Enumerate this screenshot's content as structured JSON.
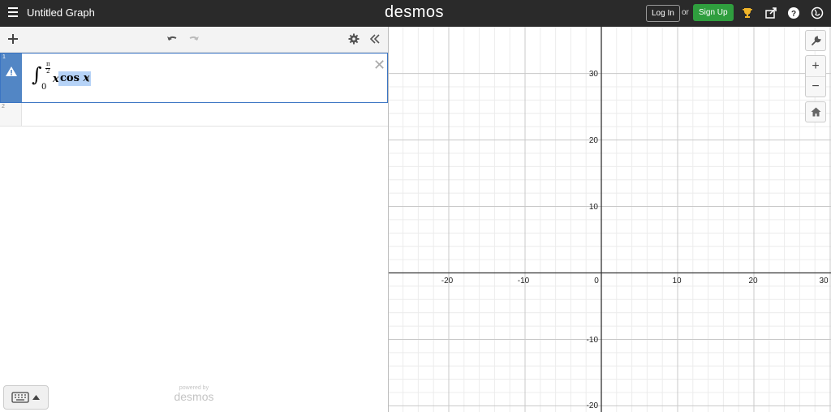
{
  "header": {
    "title": "Untitled Graph",
    "logo": "desmos",
    "login_label": "Log In",
    "or_label": "or",
    "signup_label": "Sign Up",
    "icons": [
      "menu-icon",
      "trophy-icon",
      "share-icon",
      "help-icon",
      "globe-icon"
    ]
  },
  "toolbar": {
    "icons": [
      "add-icon",
      "undo-icon",
      "redo-icon",
      "gear-icon",
      "collapse-icon"
    ]
  },
  "expressions": [
    {
      "index": "1",
      "status_icon": "warning-icon",
      "integral_lower": "0",
      "integral_upper_num": "π",
      "integral_upper_den": "2",
      "body_x": "x",
      "body_cos": "cos",
      "body_x2": "x"
    },
    {
      "index": "2"
    }
  ],
  "footer": {
    "powered_by": "powered by",
    "powered_logo": "desmos",
    "keyboard_icon": "keyboard-icon"
  },
  "graph_controls": {
    "wrench": "wrench-icon",
    "zoom_in": "+",
    "zoom_out": "−",
    "home": "home-icon"
  },
  "axis": {
    "x_labels": [
      "-20",
      "-10",
      "0",
      "10",
      "20",
      "30"
    ],
    "y_labels": [
      "30",
      "20",
      "10",
      "-10",
      "-20"
    ]
  },
  "colors": {
    "topbar": "#2a2a2a",
    "signup": "#2f9e3e",
    "selection": "#b6d3f7",
    "accent": "#5286c5"
  }
}
